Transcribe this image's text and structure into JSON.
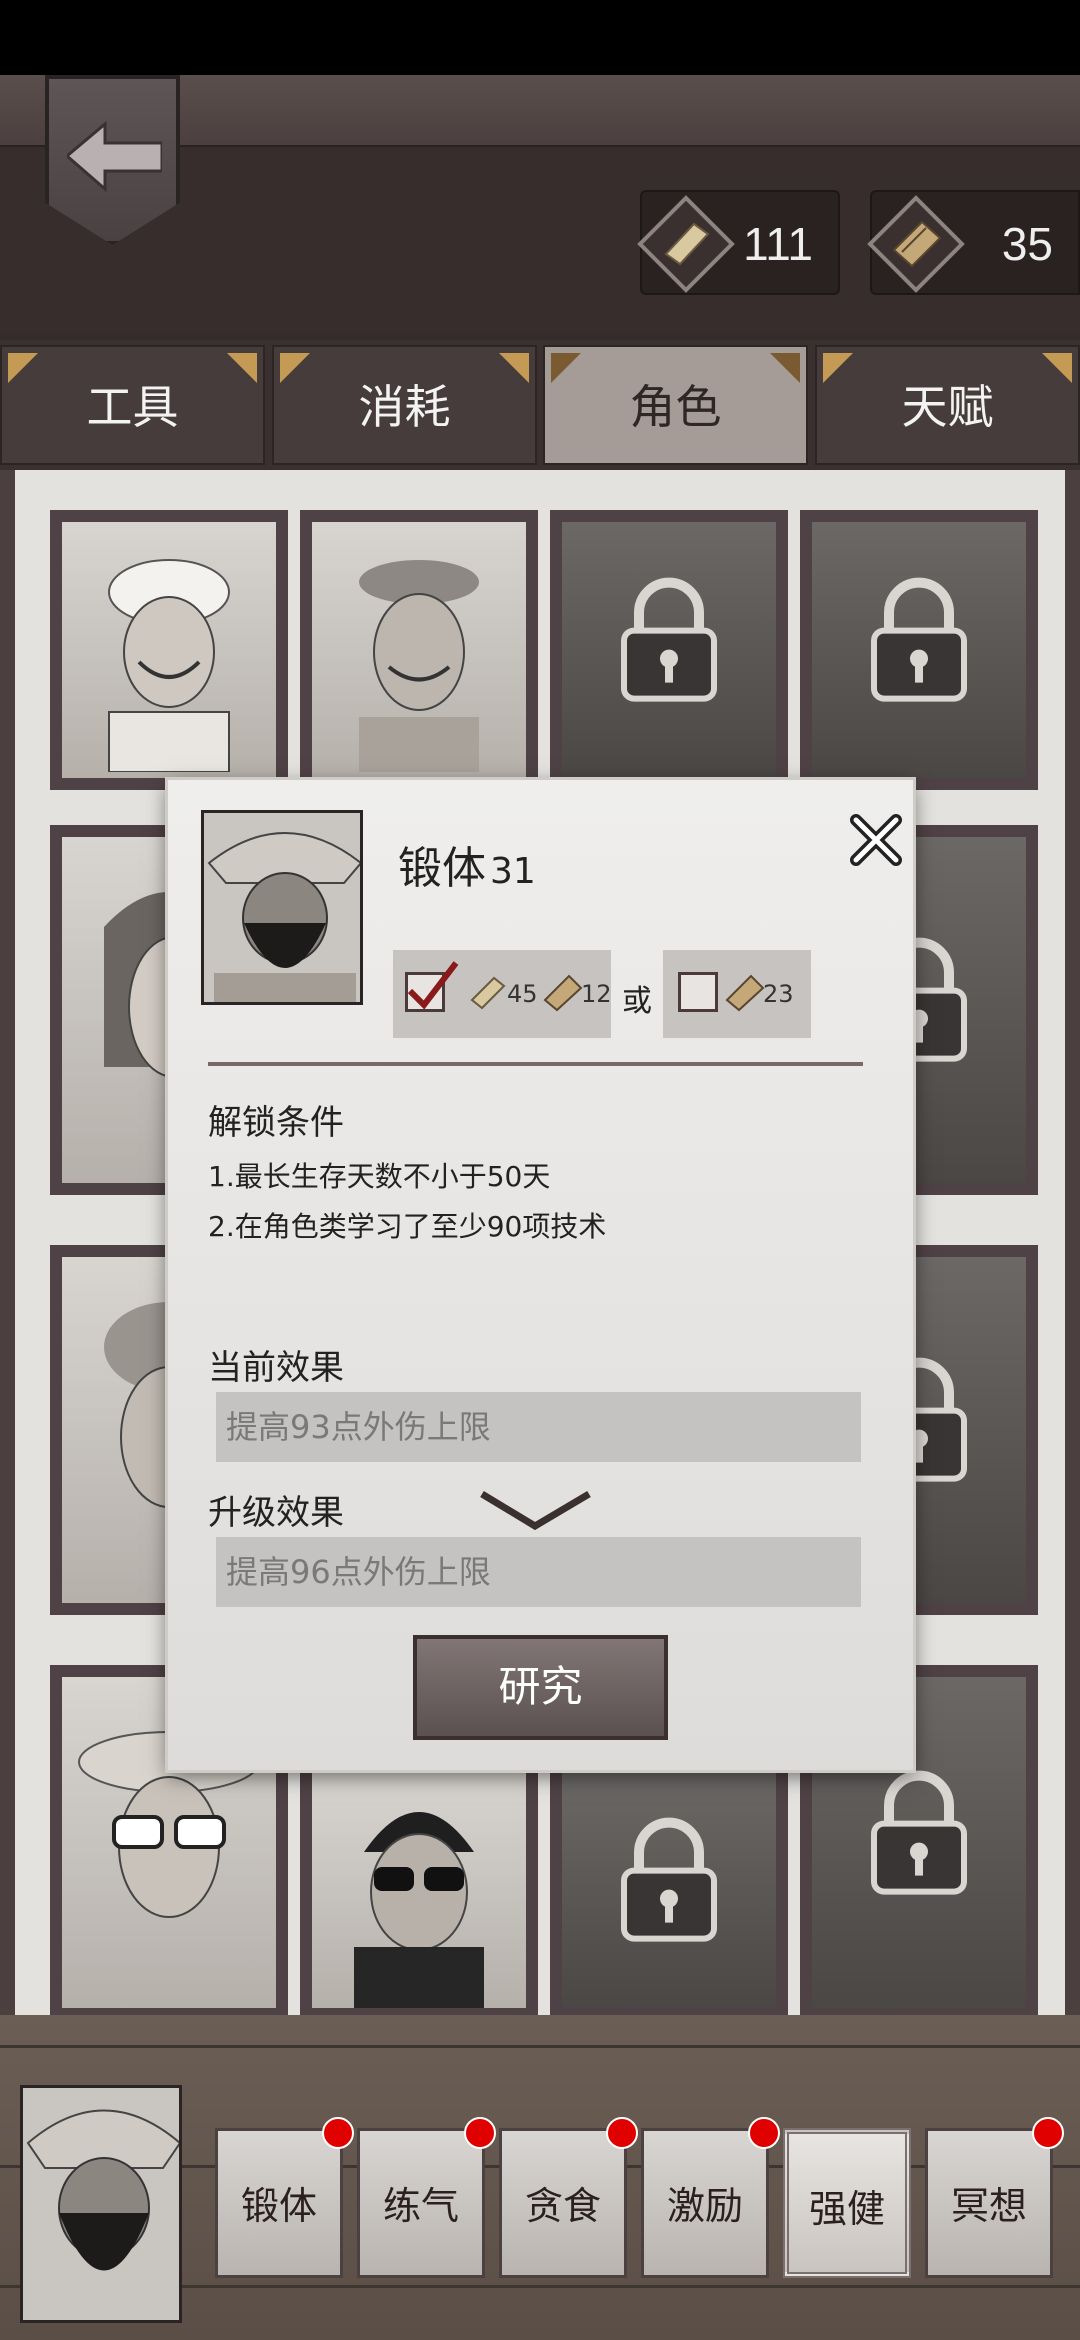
{
  "currency": [
    {
      "icon": "parchment-icon",
      "value": "111"
    },
    {
      "icon": "scroll-icon",
      "value": "35"
    }
  ],
  "tabs": [
    {
      "label": "工具",
      "active": false
    },
    {
      "label": "消耗",
      "active": false
    },
    {
      "label": "角色",
      "active": true
    },
    {
      "label": "天赋",
      "active": false
    }
  ],
  "modal": {
    "title": "锻体",
    "level": "31",
    "cost_option_a": {
      "parchment": "45",
      "scroll": "12",
      "checked": true
    },
    "or_label": "或",
    "cost_option_b": {
      "scroll": "23",
      "checked": false
    },
    "unlock_heading": "解锁条件",
    "unlock_lines": [
      "1.最长生存天数不小于50天",
      "2.在角色类学习了至少90项技术"
    ],
    "current_heading": "当前效果",
    "current_effect": "提高93点外伤上限",
    "upgrade_heading": "升级效果",
    "upgrade_effect": "提高96点外伤上限",
    "research_label": "研究"
  },
  "skills": [
    {
      "label": "锻体",
      "badge": true
    },
    {
      "label": "练气",
      "badge": true
    },
    {
      "label": "贪食",
      "badge": true
    },
    {
      "label": "激励",
      "badge": true
    },
    {
      "label": "强健",
      "badge": false,
      "selected": true
    },
    {
      "label": "冥想",
      "badge": true
    }
  ],
  "colors": {
    "accent_red": "#e00000",
    "tab_active": "#a69c97",
    "tab_inactive": "#463c3b"
  }
}
